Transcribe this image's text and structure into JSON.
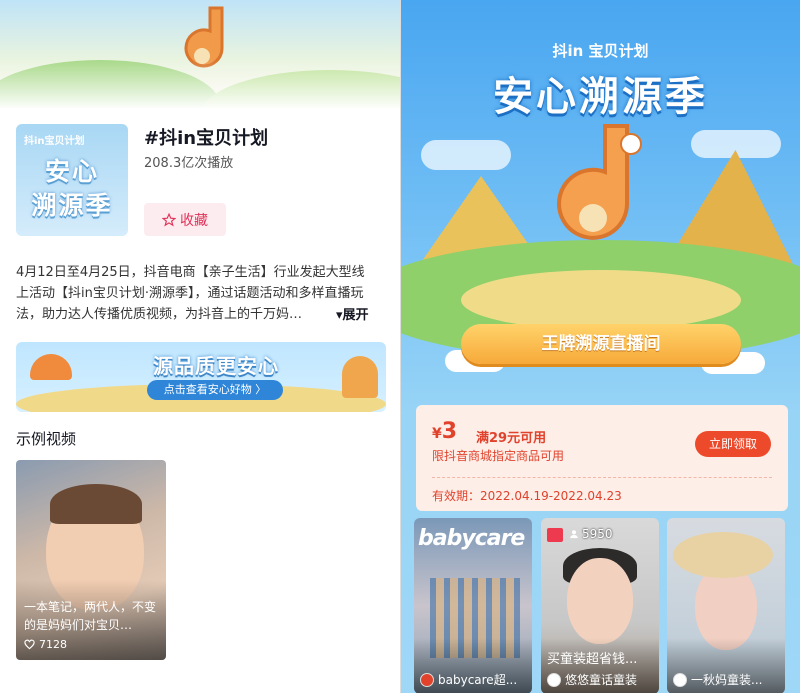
{
  "left": {
    "cover": {
      "brand": "抖in宝贝计划",
      "line1": "安心",
      "line2": "溯源季"
    },
    "topic": {
      "title": "#抖in宝贝计划",
      "plays": "208.3亿次播放"
    },
    "favorite_label": "收藏",
    "description": "4月12日至4月25日，抖音电商【亲子生活】行业发起大型线上活动【抖in宝贝计划·溯源季】，通过话题活动和多样直播玩法，助力达人传播优质视频，为抖音上的千万妈…",
    "expand_label": "展开",
    "ad": {
      "title": "源品质更安心",
      "link": "点击查看安心好物 〉"
    },
    "section_title": "示例视频",
    "video": {
      "caption": "一本笔记，两代人，不变的是妈妈们对宝贝…",
      "likes": "7128"
    }
  },
  "right": {
    "brand": "抖in 宝贝计划",
    "title": "安心溯源季",
    "live_button": "王牌溯源直播间",
    "coupon": {
      "currency": "¥",
      "amount": "3",
      "condition": "满29元可用",
      "scope": "限抖音商城指定商品可用",
      "claim_label": "立即领取",
      "validity": "有效期：2022.04.19-2022.04.23"
    },
    "streams": [
      {
        "logo": "babycare",
        "title": "",
        "author": "babycare超..."
      },
      {
        "viewers": "5950",
        "title": "买童装超省钱...",
        "author": "悠悠童话童装"
      },
      {
        "title": "",
        "author": "一秋妈童装..."
      }
    ]
  },
  "colors": {
    "accent_red": "#e0422c",
    "fav_pink": "#e0325a",
    "sky_blue": "#49a6f0",
    "gold": "#f7a93a"
  }
}
